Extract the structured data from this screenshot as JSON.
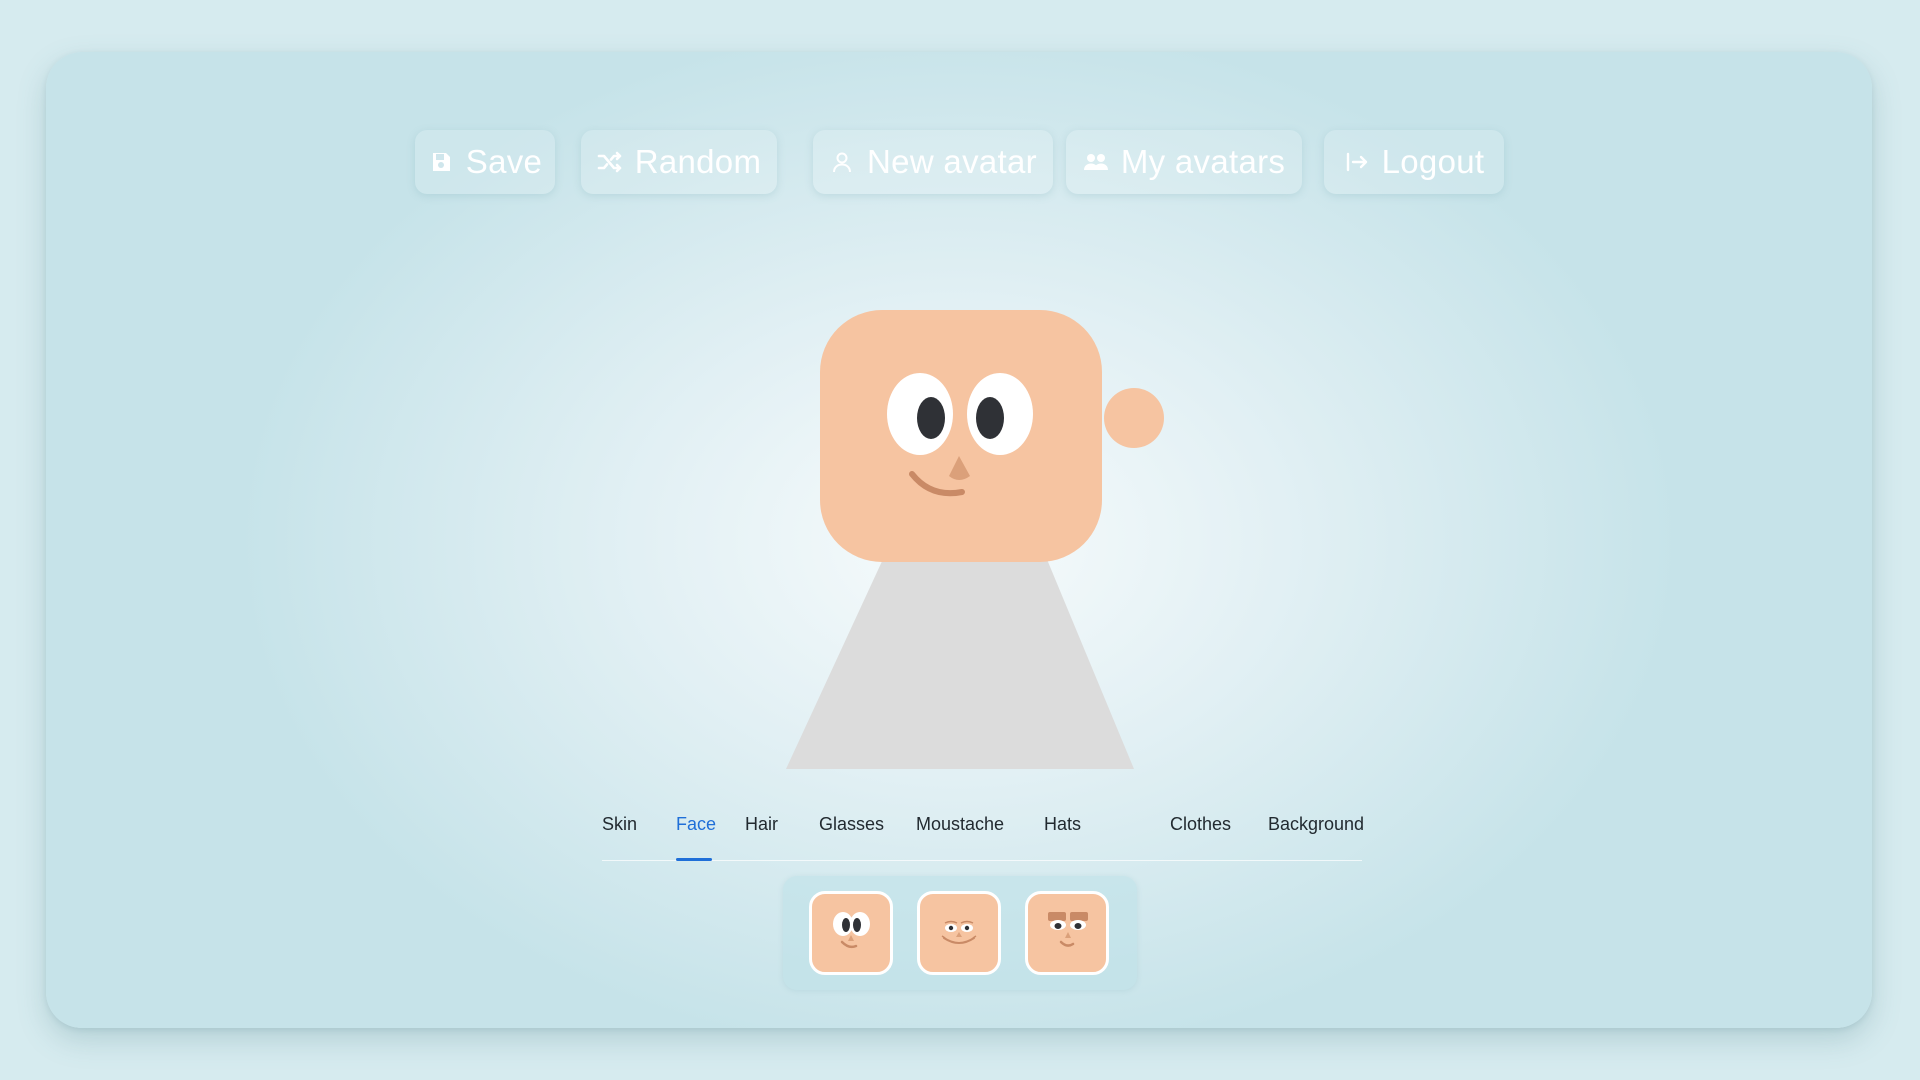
{
  "toolbar": {
    "save_label": "Save",
    "random_label": "Random",
    "new_avatar_label": "New avatar",
    "my_avatars_label": "My avatars",
    "logout_label": "Logout",
    "icons": [
      "save-icon",
      "shuffle-icon",
      "user-icon",
      "users-icon",
      "logout-icon"
    ]
  },
  "tabs": {
    "items": [
      {
        "label": "Skin"
      },
      {
        "label": "Face"
      },
      {
        "label": "Hair"
      },
      {
        "label": "Glasses"
      },
      {
        "label": "Moustache"
      },
      {
        "label": "Hats"
      },
      {
        "label": "Clothes"
      },
      {
        "label": "Background"
      }
    ],
    "active": "Face"
  },
  "face_options": [
    "face-option-wide-eyes",
    "face-option-squint-smile",
    "face-option-eyebrows"
  ],
  "colors": {
    "accent": "#1f6fd8",
    "skin": "#f6c4a1",
    "body": "#dcdcdc",
    "eye_white": "#ffffff",
    "pupil": "#2f3136",
    "nose": "#dba07a",
    "mouth": "#c98a66"
  }
}
